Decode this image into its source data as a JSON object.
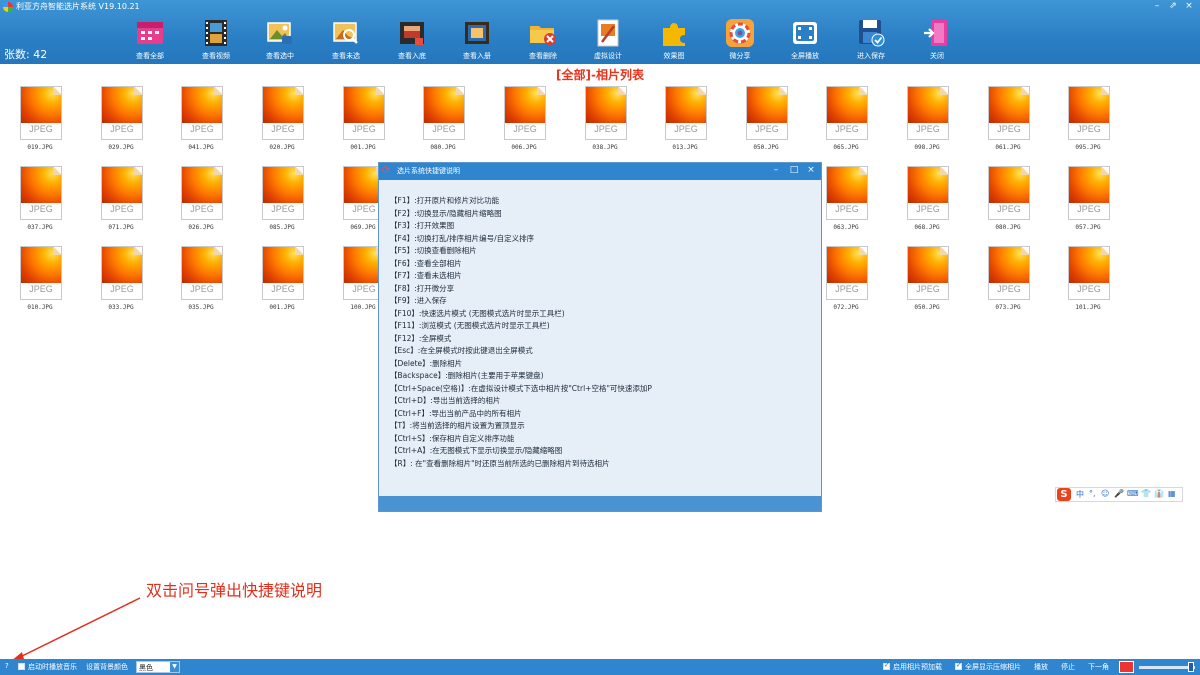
{
  "app": {
    "title": "利亚方舟智能选片系统 V19.10.21",
    "minimize": "–",
    "restore": "⇗",
    "close": "×"
  },
  "count": {
    "label": "张数: 42"
  },
  "toolbar": {
    "buttons": [
      {
        "id": "view-all",
        "label": "查看全部"
      },
      {
        "id": "view-video",
        "label": "查看视频"
      },
      {
        "id": "view-selected",
        "label": "查看选中"
      },
      {
        "id": "view-unselected",
        "label": "查看未选"
      },
      {
        "id": "view-in-book",
        "label": "查看入底"
      },
      {
        "id": "view-in-album",
        "label": "查看入册"
      },
      {
        "id": "view-deleted",
        "label": "查看删除"
      },
      {
        "id": "virtual-design",
        "label": "虚拟设计"
      },
      {
        "id": "effect-image",
        "label": "效果图"
      },
      {
        "id": "micro-share",
        "label": "微分享"
      },
      {
        "id": "fullscreen-play",
        "label": "全屏播放"
      },
      {
        "id": "enter-save",
        "label": "进入保存"
      },
      {
        "id": "close",
        "label": "关闭"
      }
    ]
  },
  "list": {
    "title": "[全部]-相片列表"
  },
  "thumbs": {
    "ext": "JPEG",
    "rows": [
      [
        "019.JPG",
        "029.JPG",
        "041.JPG",
        "020.JPG",
        "001.JPG",
        "080.JPG",
        "006.JPG",
        "038.JPG",
        "013.JPG",
        "050.JPG",
        "065.JPG",
        "098.JPG",
        "061.JPG",
        "095.JPG"
      ],
      [
        "037.JPG",
        "071.JPG",
        "026.JPG",
        "085.JPG",
        "069.JPG",
        "",
        "",
        "",
        "",
        "",
        "063.JPG",
        "068.JPG",
        "080.JPG",
        "057.JPG"
      ],
      [
        "010.JPG",
        "033.JPG",
        "035.JPG",
        "001.JPG",
        "100.JPG",
        "",
        "",
        "",
        "",
        "",
        "072.JPG",
        "050.JPG",
        "073.JPG",
        "101.JPG"
      ]
    ]
  },
  "dialog": {
    "title": "选片系统快捷键说明",
    "minimize": "–",
    "maximize": "□",
    "close": "×",
    "lines": [
      "【F1】:打开原片和修片对比功能",
      "【F2】:切换显示/隐藏相片缩略图",
      "【F3】:打开效果图",
      "【F4】:切换打乱/排序相片编号/自定义排序",
      "【F5】:切换查看删除相片",
      "【F6】:查看全部相片",
      "【F7】:查看未选相片",
      "【F8】:打开微分享",
      "【F9】:进入保存",
      "【F10】:快速选片模式 (无图模式选片时显示工具栏)",
      "【F11】:浏览模式 (无图模式选片时显示工具栏)",
      "【F12】:全屏模式",
      "【Esc】:在全屏模式时按此键退出全屏模式",
      "【Delete】:删除相片",
      "【Backspace】:删除相片(主要用于苹果键盘)",
      "【Ctrl+Space(空格)】:在虚拟设计模式下选中相片按\"Ctrl+空格\"可快速添加P",
      "【Ctrl+D】:导出当前选择的相片",
      "【Ctrl+F】:导出当前产品中的所有相片",
      "【T】:将当前选择的相片设置为置顶显示",
      "【Ctrl+S】:保存相片自定义排序功能",
      "【Ctrl+A】:在无图模式下显示切换显示/隐藏缩略图",
      "【R】: 在\"查看删除相片\"时还原当前所选的已删除相片到待选相片"
    ]
  },
  "ime": {
    "logo": "S",
    "items": [
      "中",
      "°,",
      "☺",
      "🎤",
      "⌨",
      "👕",
      "👔",
      "▦"
    ]
  },
  "annotation": {
    "text": "双击问号弹出快捷键说明"
  },
  "status": {
    "help": "?",
    "music_label": "启动时播放音乐",
    "bg_color_label": "设置背景颜色",
    "bg_color_value": "黑色",
    "preload_label": "启用相片预加载",
    "fullscreen_label": "全屏显示压缩相片",
    "play": "播放",
    "stop": "停止",
    "prev": "下一角"
  },
  "colors": {
    "toolbar": "#2a7fc4",
    "accent_red": "#e8341c",
    "dialog_bg": "#e6eff8"
  }
}
